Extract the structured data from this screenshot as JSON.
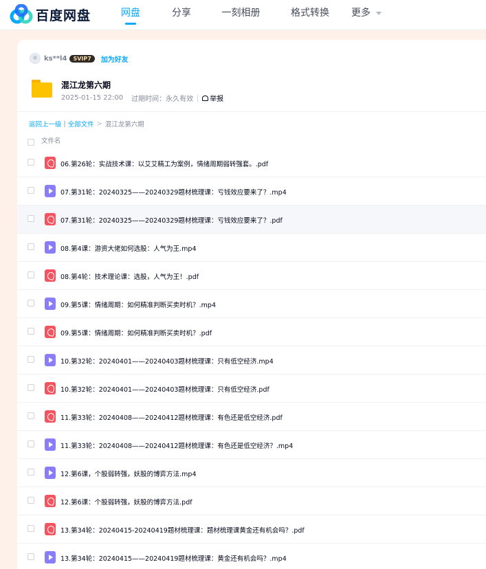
{
  "brand": {
    "name": "百度网盘"
  },
  "nav": [
    {
      "label": "网盘",
      "active": true
    },
    {
      "label": "分享",
      "active": false
    },
    {
      "label": "一刻相册",
      "active": false
    },
    {
      "label": "格式转换",
      "active": false
    },
    {
      "label": "更多",
      "active": false
    }
  ],
  "sharer": {
    "name": "ks**l4",
    "badge": "SVIP7",
    "add_friend": "加为好友"
  },
  "share": {
    "title": "混江龙第六期",
    "date": "2025-01-15 22:00",
    "expiry_label": "过期时间：永久有效",
    "report_label": "举报"
  },
  "breadcrumb": {
    "back": "返回上一级",
    "sep": "|",
    "all": "全部文件",
    "arrow": ">",
    "current": "混江龙第六期"
  },
  "list": {
    "header": "文件名",
    "rows": [
      {
        "type": "pdf",
        "name": "06.第26轮：实战技术课：以艾艾精工为案例，情绪周期弱转强套。.pdf"
      },
      {
        "type": "mp4",
        "name": "07.第31轮：20240325——20240329题材梳理课：亏钱效应要来了？.mp4"
      },
      {
        "type": "pdf",
        "name": "07.第31轮：20240325——20240329题材梳理课：亏钱效应要来了？.pdf"
      },
      {
        "type": "mp4",
        "name": "08.第4课：游资大佬如何选股：人气为王.mp4"
      },
      {
        "type": "pdf",
        "name": "08.第4轮：技术理论课：选股，人气为王！.pdf"
      },
      {
        "type": "mp4",
        "name": "09.第5课：情绪周期：如何精准判断买卖时机？.mp4"
      },
      {
        "type": "pdf",
        "name": "09.第5课：情绪周期：如何精准判断买卖时机？.pdf"
      },
      {
        "type": "mp4",
        "name": "10.第32轮：20240401——20240403题材梳理课：只有低空经济.mp4"
      },
      {
        "type": "pdf",
        "name": "10.第32轮：20240401——20240403题材梳理课：只有低空经济.pdf"
      },
      {
        "type": "pdf",
        "name": "11.第33轮：20240408——20240412题材梳理课：有色还是低空经济.pdf"
      },
      {
        "type": "mp4",
        "name": "11.第33轮：20240408——20240412题材梳理课：有色还是低空经济？.mp4"
      },
      {
        "type": "mp4",
        "name": "12.第6课，个股弱转强，妖股的博弈方法.mp4"
      },
      {
        "type": "pdf",
        "name": "12.第6课：个股弱转强，妖股的博弈方法.pdf"
      },
      {
        "type": "pdf",
        "name": "13.第34轮：20240415-20240419题材梳理课：题材梳理课黄金还有机会吗？.pdf"
      },
      {
        "type": "mp4",
        "name": "13.第34轮：20240415——20240419题材梳理课：黄金还有机会吗？.mp4"
      }
    ]
  },
  "colors": {
    "accent": "#06a7ff",
    "pdf": "#f45360",
    "mp4": "#8a7dfa",
    "folder": "#fec300",
    "background": "#fdf1ea"
  },
  "icons": {
    "logo": "baidu-netdisk-logo",
    "folder": "folder-icon",
    "pdf": "pdf-file-icon",
    "mp4": "video-file-icon",
    "report": "report-icon"
  }
}
